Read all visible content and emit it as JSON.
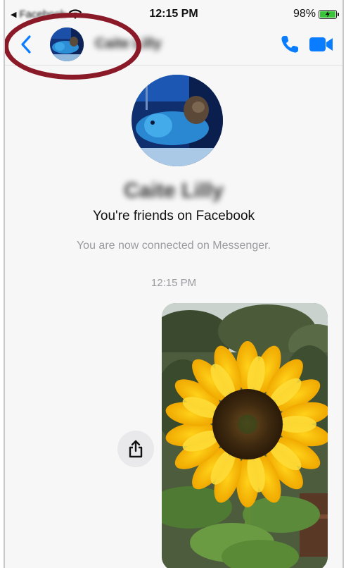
{
  "status_bar": {
    "back_app": "Facebook",
    "time": "12:15 PM",
    "battery": "98%"
  },
  "header": {
    "contact_name": "Caite Lilly",
    "icons": [
      "chevron-left-icon",
      "phone-icon",
      "video-camera-icon"
    ]
  },
  "conversation": {
    "profile_name": "Caite Lilly",
    "friends_text": "You're friends on Facebook",
    "connected_text": "You are now connected on Messenger.",
    "timestamp": "12:15 PM",
    "shared_photo": "sunflower photo"
  },
  "colors": {
    "accent": "#0a7cff",
    "highlight": "#8b1a28",
    "muted_text": "#9a9a9e",
    "background": "#f7f7f8"
  }
}
